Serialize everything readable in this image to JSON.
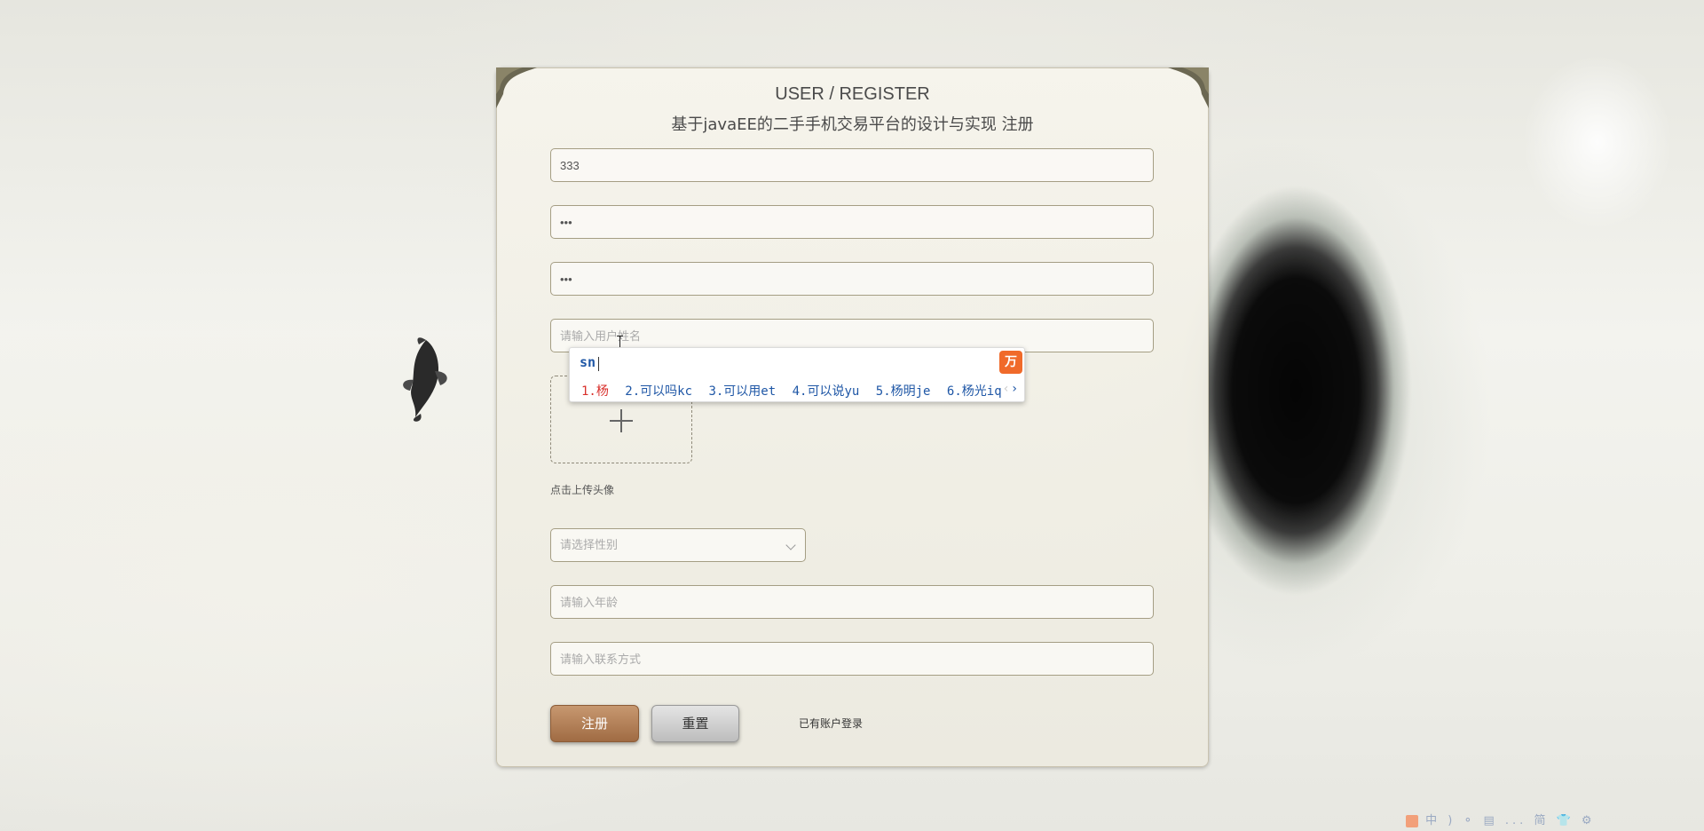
{
  "header": {
    "title_en": "USER / REGISTER",
    "title_cn": "基于javaEE的二手手机交易平台的设计与实现 注册"
  },
  "form": {
    "username": {
      "value": "333"
    },
    "password": {
      "value": "•••"
    },
    "password_confirm": {
      "value": "•••"
    },
    "real_name": {
      "placeholder": "请输入用户姓名"
    },
    "avatar": {
      "label": "点击上传头像"
    },
    "gender": {
      "placeholder": "请选择性别"
    },
    "age": {
      "placeholder": "请输入年龄"
    },
    "contact": {
      "placeholder": "请输入联系方式"
    }
  },
  "actions": {
    "register_label": "注册",
    "reset_label": "重置",
    "login_link": "已有账户登录"
  },
  "ime": {
    "input": "sn",
    "logo_icon": "ime-logo-icon",
    "candidates": [
      "1.杨",
      "2.可以吗kc",
      "3.可以用et",
      "4.可以说yu",
      "5.杨明je",
      "6.杨光iq"
    ],
    "prev_arrow": "‹",
    "next_arrow": "›",
    "accent_color": "#1f57a6",
    "highlight_color": "#d9302c"
  },
  "tray": {
    "items": "中 ) ⚬ ▤ ... 简 👕 ⚙"
  },
  "colors": {
    "primary_button": "#b07a4f",
    "secondary_button": "#cfcfcf"
  }
}
